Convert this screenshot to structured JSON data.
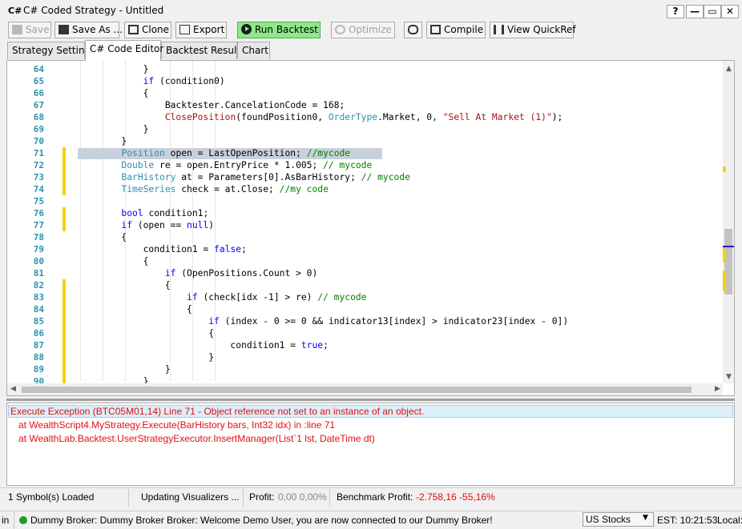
{
  "window": {
    "icon_text": "C#",
    "title": "C# Coded Strategy - Untitled",
    "buttons": [
      "?",
      "—",
      "▭",
      "✕"
    ]
  },
  "toolbar": {
    "save": "Save",
    "save_as": "Save As ...",
    "clone": "Clone",
    "export": "Export",
    "run_backtest": "Run Backtest",
    "optimize": "Optimize",
    "compile": "Compile",
    "view_quickref": "View QuickRef"
  },
  "tabs": [
    "Strategy Settings",
    "C# Code Editor",
    "Backtest Results",
    "Chart"
  ],
  "editor": {
    "line_numbers": [
      "64",
      "65",
      "66",
      "67",
      "68",
      "69",
      "70",
      "71",
      "72",
      "73",
      "74",
      "75",
      "76",
      "77",
      "78",
      "79",
      "80",
      "81",
      "82",
      "83",
      "84",
      "85",
      "86",
      "87",
      "88",
      "89",
      "90"
    ],
    "lines": [
      [
        {
          "t": "            }",
          "c": ""
        }
      ],
      [
        {
          "t": "            ",
          "c": ""
        },
        {
          "t": "if",
          "c": "kw"
        },
        {
          "t": " (condition0)",
          "c": ""
        }
      ],
      [
        {
          "t": "            {",
          "c": ""
        }
      ],
      [
        {
          "t": "                Backtester.CancelationCode = 168;",
          "c": ""
        }
      ],
      [
        {
          "t": "                ",
          "c": ""
        },
        {
          "t": "ClosePosition",
          "c": "mt"
        },
        {
          "t": "(foundPosition0, ",
          "c": ""
        },
        {
          "t": "OrderType",
          "c": "ty"
        },
        {
          "t": ".Market, 0, ",
          "c": ""
        },
        {
          "t": "\"Sell At Market (1)\"",
          "c": "st"
        },
        {
          "t": ");",
          "c": ""
        }
      ],
      [
        {
          "t": "            }",
          "c": ""
        }
      ],
      [
        {
          "t": "        }",
          "c": ""
        }
      ],
      [
        {
          "t": "        ",
          "c": ""
        },
        {
          "t": "Position",
          "c": "ty"
        },
        {
          "t": " open = LastOpenPosition; ",
          "c": ""
        },
        {
          "t": "//mycode",
          "c": "cm"
        }
      ],
      [
        {
          "t": "        ",
          "c": ""
        },
        {
          "t": "Double",
          "c": "ty"
        },
        {
          "t": " re = open.EntryPrice * 1.005; ",
          "c": ""
        },
        {
          "t": "// mycode",
          "c": "cm"
        }
      ],
      [
        {
          "t": "        ",
          "c": ""
        },
        {
          "t": "BarHistory",
          "c": "ty"
        },
        {
          "t": " at = Parameters[0].AsBarHistory; ",
          "c": ""
        },
        {
          "t": "// mycode",
          "c": "cm"
        }
      ],
      [
        {
          "t": "        ",
          "c": ""
        },
        {
          "t": "TimeSeries",
          "c": "ty"
        },
        {
          "t": " check = at.Close; ",
          "c": ""
        },
        {
          "t": "//my code",
          "c": "cm"
        }
      ],
      [
        {
          "t": "",
          "c": ""
        }
      ],
      [
        {
          "t": "        ",
          "c": ""
        },
        {
          "t": "bool",
          "c": "kw"
        },
        {
          "t": " condition1;",
          "c": ""
        }
      ],
      [
        {
          "t": "        ",
          "c": ""
        },
        {
          "t": "if",
          "c": "kw"
        },
        {
          "t": " (open == ",
          "c": ""
        },
        {
          "t": "null",
          "c": "kw"
        },
        {
          "t": ")",
          "c": ""
        }
      ],
      [
        {
          "t": "        {",
          "c": ""
        }
      ],
      [
        {
          "t": "            condition1 = ",
          "c": ""
        },
        {
          "t": "false",
          "c": "kw"
        },
        {
          "t": ";",
          "c": ""
        }
      ],
      [
        {
          "t": "            {",
          "c": ""
        }
      ],
      [
        {
          "t": "                ",
          "c": ""
        },
        {
          "t": "if",
          "c": "kw"
        },
        {
          "t": " (OpenPositions.Count > 0)",
          "c": ""
        }
      ],
      [
        {
          "t": "                {",
          "c": ""
        }
      ],
      [
        {
          "t": "                    ",
          "c": ""
        },
        {
          "t": "if",
          "c": "kw"
        },
        {
          "t": " (check[idx -1] > re) ",
          "c": ""
        },
        {
          "t": "// mycode",
          "c": "cm"
        }
      ],
      [
        {
          "t": "                    {",
          "c": ""
        }
      ],
      [
        {
          "t": "                        ",
          "c": ""
        },
        {
          "t": "if",
          "c": "kw"
        },
        {
          "t": " (index - 0 >= 0 && indicator13[index] > indicator23[index - 0])",
          "c": ""
        }
      ],
      [
        {
          "t": "                        {",
          "c": ""
        }
      ],
      [
        {
          "t": "                            condition1 = ",
          "c": ""
        },
        {
          "t": "true",
          "c": "kw"
        },
        {
          "t": ";",
          "c": ""
        }
      ],
      [
        {
          "t": "                        }",
          "c": ""
        }
      ],
      [
        {
          "t": "                }",
          "c": ""
        }
      ],
      [
        {
          "t": "            }",
          "c": ""
        }
      ]
    ],
    "highlighted_line": "71",
    "marked_lines": [
      "71",
      "72",
      "73",
      "74",
      "76",
      "77",
      "82",
      "83",
      "84",
      "85",
      "86",
      "87",
      "88",
      "89",
      "90"
    ]
  },
  "output": {
    "error": "Execute Exception (BTC05M01,14) Line 71 - Object reference not set to an instance of an object.",
    "trace": [
      "at WealthScript4.MyStrategy.Execute(BarHistory bars, Int32 idx) in :line 71",
      "at WealthLab.Backtest.UserStrategyExecutor.InsertManager(List`1 lst, DateTime dt)"
    ]
  },
  "status": {
    "symbols": "1 Symbol(s) Loaded",
    "updating": "Updating Visualizers ...",
    "profit_label": "Profit:",
    "profit_value": "0,00 0,00%",
    "benchmark_label": "Benchmark Profit:",
    "benchmark_value": "-2.758,16 -55,16%"
  },
  "bottom": {
    "left_text": "in",
    "broker_message": "Dummy Broker: Dummy Broker Broker: Welcome Demo User, you are now connected to our Dummy Broker!",
    "market_select": "US Stocks",
    "time": "EST: 10:21:53",
    "local": "Local:"
  },
  "colors": {
    "error": "#e01010",
    "run_button": "#8fe88a",
    "keyword": "#0000ff",
    "type": "#2b91af",
    "comment": "#008000",
    "string": "#a31515",
    "change_marker": "#f5d20a",
    "connected": "#1e9e1e"
  }
}
